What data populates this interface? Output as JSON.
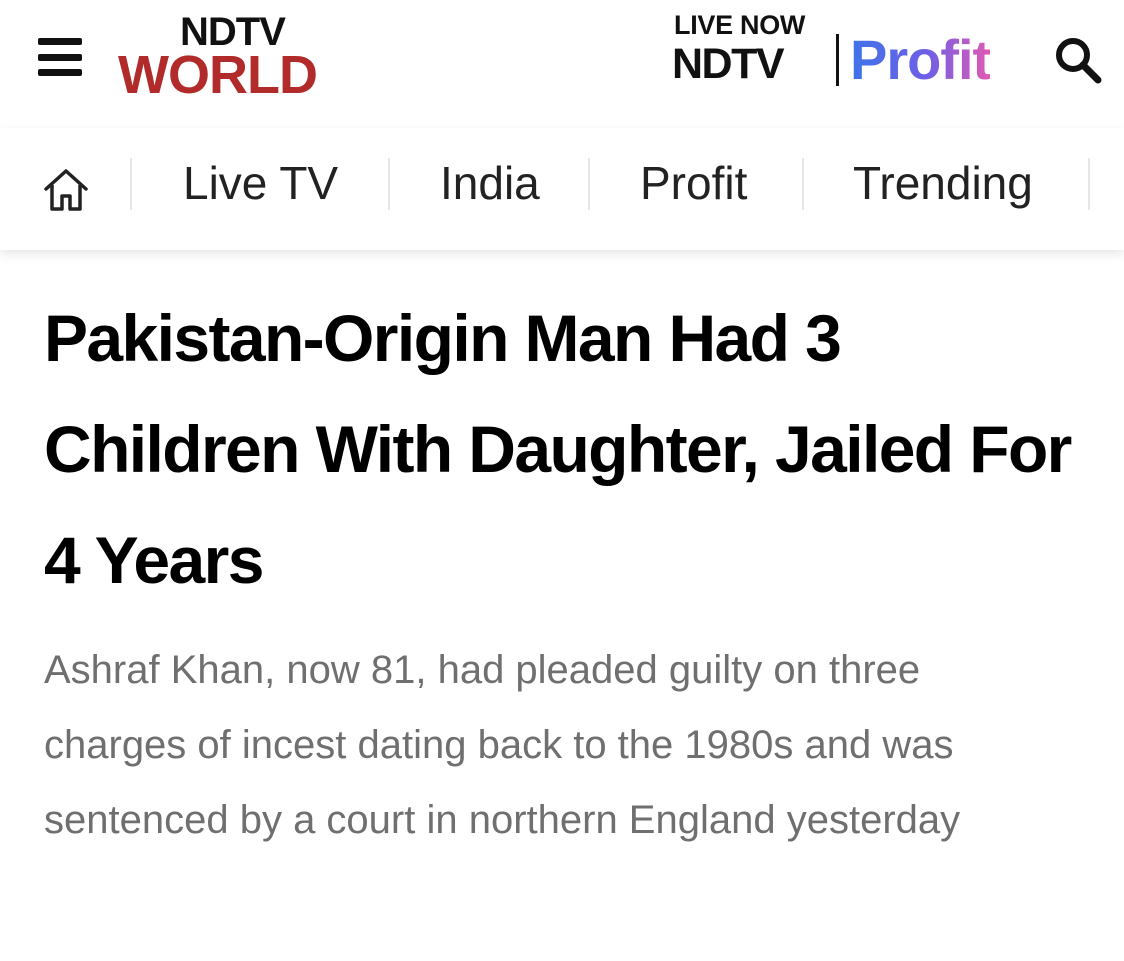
{
  "header": {
    "logo": {
      "top": "NDTV",
      "bottom": "WORLD"
    },
    "live": {
      "label": "LIVE NOW",
      "channel": "NDTV",
      "brand": "Profit"
    },
    "icons": {
      "menu": "menu-icon",
      "search": "search-icon",
      "home": "home-icon"
    }
  },
  "nav": {
    "items": [
      {
        "label": "Live TV"
      },
      {
        "label": "India"
      },
      {
        "label": "Profit"
      },
      {
        "label": "Trending"
      }
    ]
  },
  "article": {
    "headline": "Pakistan-Origin Man Had 3 Children With Daughter, Jailed For 4 Years",
    "summary": "Ashraf Khan, now 81, had pleaded guilty on three charges of incest dating back to the 1980s and was sentenced by a court in northern England yesterday"
  },
  "colors": {
    "brand_red": "#b22b2b",
    "text_primary": "#000000",
    "text_secondary": "#6f6f6f",
    "profit_gradient": [
      "#3e74e8",
      "#6e5fe6",
      "#e05ab3"
    ]
  }
}
